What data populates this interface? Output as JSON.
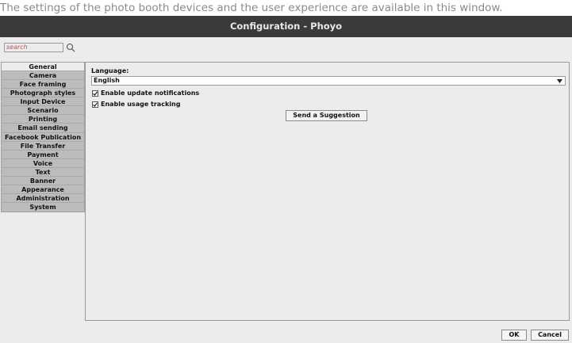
{
  "caption": "The settings of the photo booth devices and the user experience are available in this window.",
  "window": {
    "title": "Configuration - Phoyo"
  },
  "search": {
    "placeholder": "search",
    "icon": "search-icon"
  },
  "tabs": [
    {
      "label": "General",
      "active": true
    },
    {
      "label": "Camera"
    },
    {
      "label": "Face framing"
    },
    {
      "label": "Photograph styles"
    },
    {
      "label": "Input Device"
    },
    {
      "label": "Scenario"
    },
    {
      "label": "Printing"
    },
    {
      "label": "Email sending"
    },
    {
      "label": "Facebook Publication"
    },
    {
      "label": "File Transfer"
    },
    {
      "label": "Payment"
    },
    {
      "label": "Voice"
    },
    {
      "label": "Text"
    },
    {
      "label": "Banner"
    },
    {
      "label": "Appearance"
    },
    {
      "label": "Administration"
    },
    {
      "label": "System"
    }
  ],
  "general": {
    "language_label": "Language:",
    "language_value": "English",
    "update_notifications_label": "Enable update notifications",
    "update_notifications_checked": true,
    "usage_tracking_label": "Enable usage tracking",
    "usage_tracking_checked": true,
    "suggestion_button": "Send a Suggestion"
  },
  "footer": {
    "ok_label": "OK",
    "cancel_label": "Cancel"
  },
  "colors": {
    "titlebar": "#3a3a3a",
    "window_bg": "#ececec",
    "tab_bg": "#bcbcbc",
    "search_text": "#d05050"
  }
}
